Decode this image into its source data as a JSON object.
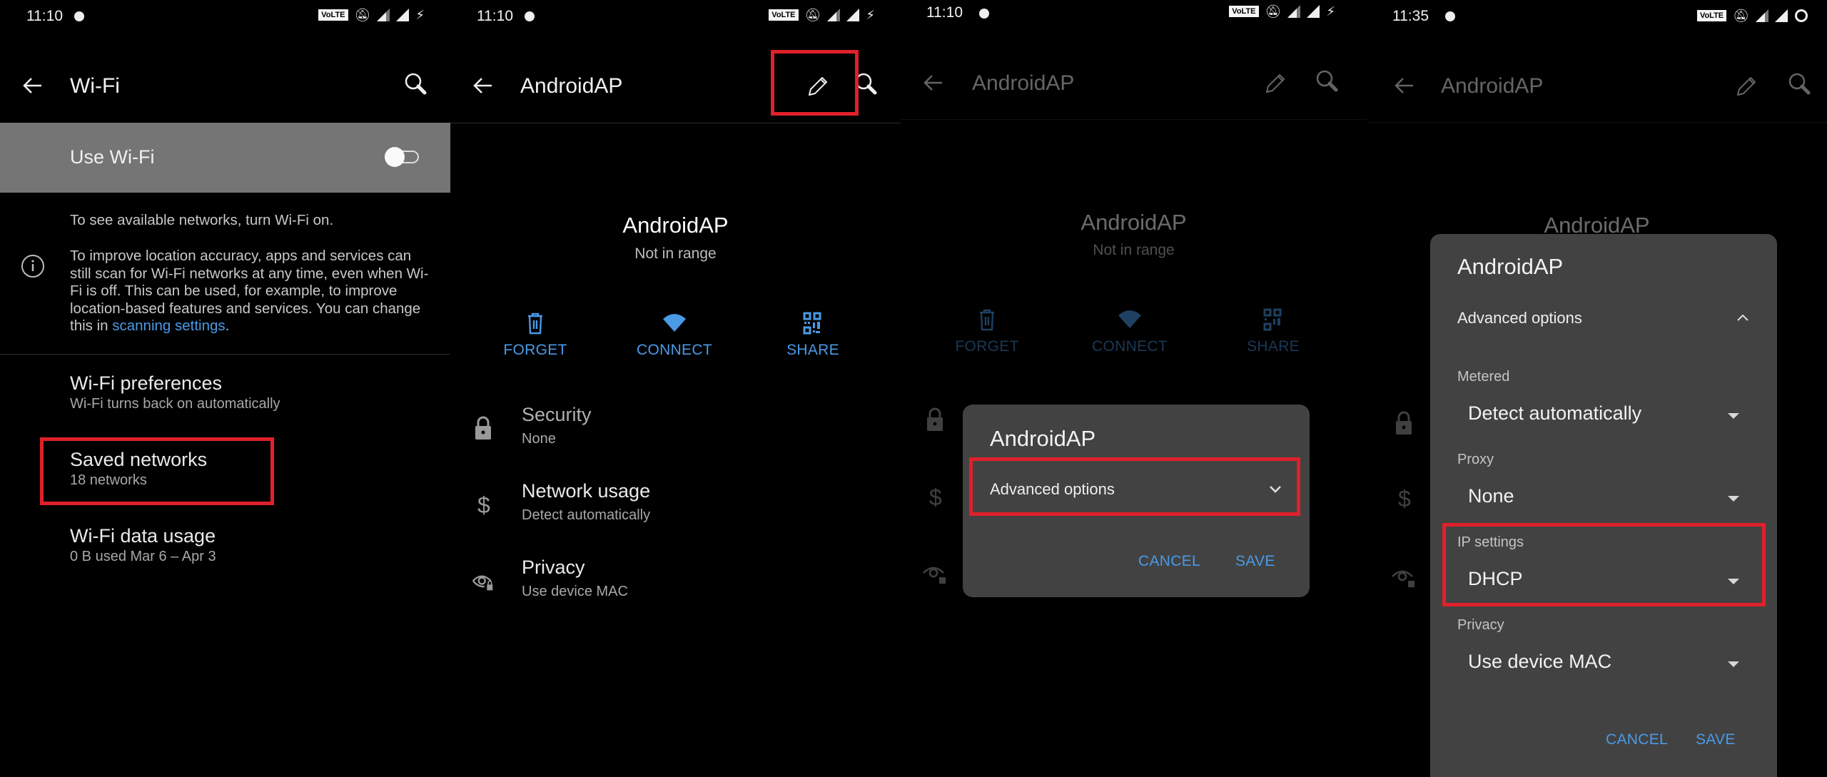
{
  "colors": {
    "accent": "#4a9ae6",
    "highlight": "#e0202a",
    "dialog_bg": "#424242",
    "toggle_row_bg": "#757575"
  },
  "panels": [
    {
      "status": {
        "time": "11:10",
        "volte": "VoLTE",
        "network": "4G"
      },
      "appbar": {
        "title": "Wi-Fi",
        "back_icon": "arrow-back-icon",
        "search_icon": "search-icon"
      },
      "use_wifi": {
        "label": "Use Wi-Fi",
        "state": "off"
      },
      "notice": "To see available networks, turn Wi-Fi on.",
      "scan_info": {
        "text": "To improve location accuracy, apps and services can still scan for Wi-Fi networks at any time, even when Wi-Fi is off. This can be used, for example, to improve location-based features and services. You can change this in ",
        "link": "scanning settings",
        "suffix": "."
      },
      "items": [
        {
          "title": "Wi-Fi preferences",
          "subtitle": "Wi-Fi turns back on automatically"
        },
        {
          "title": "Saved networks",
          "subtitle": "18 networks",
          "highlighted": true
        },
        {
          "title": "Wi-Fi data usage",
          "subtitle": "0 B used Mar 6 – Apr 3"
        }
      ]
    },
    {
      "status": {
        "time": "11:10",
        "volte": "VoLTE",
        "network": "4G"
      },
      "appbar": {
        "title": "AndroidAP",
        "edit_highlighted": true
      },
      "network": {
        "name": "AndroidAP",
        "status": "Not in range"
      },
      "actions": [
        {
          "label": "FORGET",
          "icon": "trash-icon"
        },
        {
          "label": "CONNECT",
          "icon": "wifi-icon"
        },
        {
          "label": "SHARE",
          "icon": "qr-code-icon"
        }
      ],
      "details": [
        {
          "title": "Security",
          "value": "None",
          "icon": "lock-icon"
        },
        {
          "title": "Network usage",
          "value": "Detect automatically",
          "icon": "dollar-icon"
        },
        {
          "title": "Privacy",
          "value": "Use device MAC",
          "icon": "eye-lock-icon"
        }
      ]
    },
    {
      "status": {
        "time": "11:10",
        "volte": "VoLTE",
        "network": "4G"
      },
      "appbar": {
        "title": "AndroidAP"
      },
      "network": {
        "name": "AndroidAP",
        "status": "Not in range"
      },
      "actions": [
        {
          "label": "FORGET"
        },
        {
          "label": "CONNECT"
        },
        {
          "label": "SHARE"
        }
      ],
      "dialog": {
        "title": "AndroidAP",
        "advanced_label": "Advanced options",
        "expanded": false,
        "cancel": "CANCEL",
        "save": "SAVE"
      }
    },
    {
      "status": {
        "time": "11:35",
        "volte": "VoLTE",
        "network": "4G"
      },
      "appbar": {
        "title": "AndroidAP"
      },
      "network": {
        "name": "AndroidAP"
      },
      "dialog": {
        "title": "AndroidAP",
        "advanced_label": "Advanced options",
        "expanded": true,
        "fields": [
          {
            "label": "Metered",
            "value": "Detect automatically"
          },
          {
            "label": "Proxy",
            "value": "None"
          },
          {
            "label": "IP settings",
            "value": "DHCP",
            "highlighted": true
          },
          {
            "label": "Privacy",
            "value": "Use device MAC"
          }
        ],
        "cancel": "CANCEL",
        "save": "SAVE"
      }
    }
  ]
}
